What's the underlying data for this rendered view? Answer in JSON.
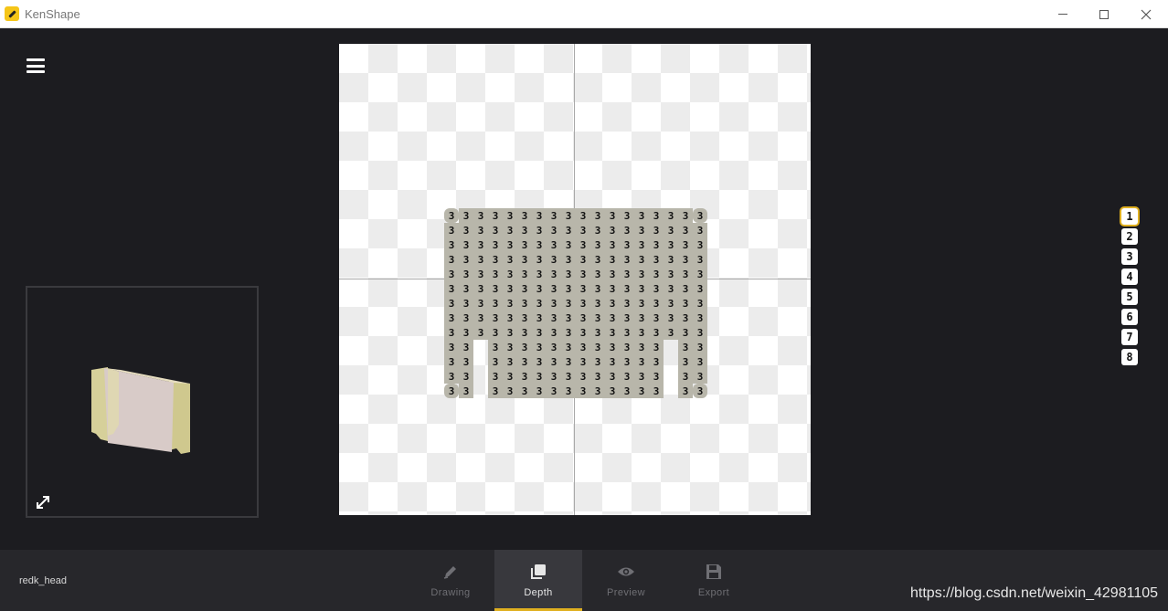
{
  "window": {
    "title": "KenShape",
    "icon": "pencil-icon"
  },
  "menu": {
    "icon": "hamburger-menu-icon"
  },
  "preview": {
    "icon": "expand-arrows-icon"
  },
  "depth_levels": [
    "1",
    "2",
    "3",
    "4",
    "5",
    "6",
    "7",
    "8"
  ],
  "selected_depth": "1",
  "shape": {
    "cell_label": "3",
    "colors": {
      "fill": "#b8b6aa",
      "glyph": "#111111"
    }
  },
  "bottom_bar": {
    "project_name": "redk_head",
    "tabs": [
      {
        "label": "Drawing",
        "icon": "pencil-icon"
      },
      {
        "label": "Depth",
        "icon": "layers-icon",
        "active": true
      },
      {
        "label": "Preview",
        "icon": "eye-icon"
      },
      {
        "label": "Export",
        "icon": "floppy-save-icon"
      }
    ],
    "watermark": "https://blog.csdn.net/weixin_42981105"
  },
  "colors": {
    "background": "#1c1c20",
    "accent": "#e0b020",
    "bar": "#27272b"
  }
}
